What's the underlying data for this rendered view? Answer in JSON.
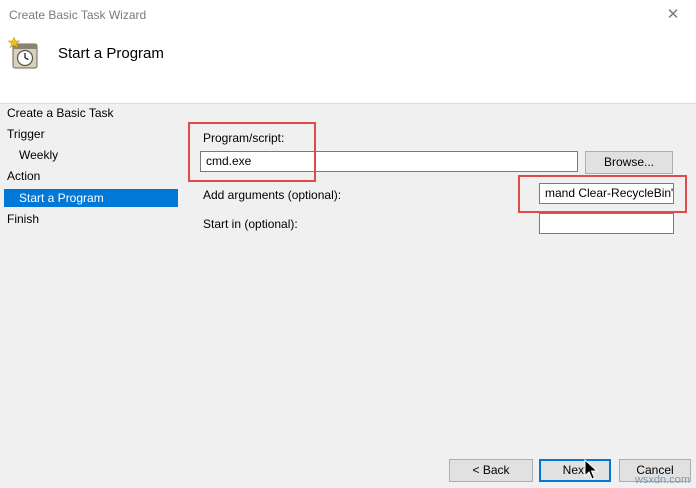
{
  "window": {
    "title": "Create Basic Task Wizard",
    "close_glyph": "✕"
  },
  "header": {
    "page_title": "Start a Program"
  },
  "nav": {
    "items": [
      "Create a Basic Task",
      "Trigger",
      "Weekly",
      "Action",
      "Start a Program",
      "Finish"
    ]
  },
  "form": {
    "program_label": "Program/script:",
    "program_value": "cmd.exe",
    "browse_label": "Browse...",
    "args_label": "Add arguments (optional):",
    "args_value": "mand Clear-RecycleBin\"",
    "start_in_label": "Start in (optional):",
    "start_in_value": ""
  },
  "footer": {
    "back_label": "< Back",
    "next_label": "Next",
    "cancel_label": "Cancel"
  },
  "watermark": "wsxdn.com",
  "colors": {
    "selection": "#0078d7",
    "highlight_box": "#e24a4a"
  }
}
